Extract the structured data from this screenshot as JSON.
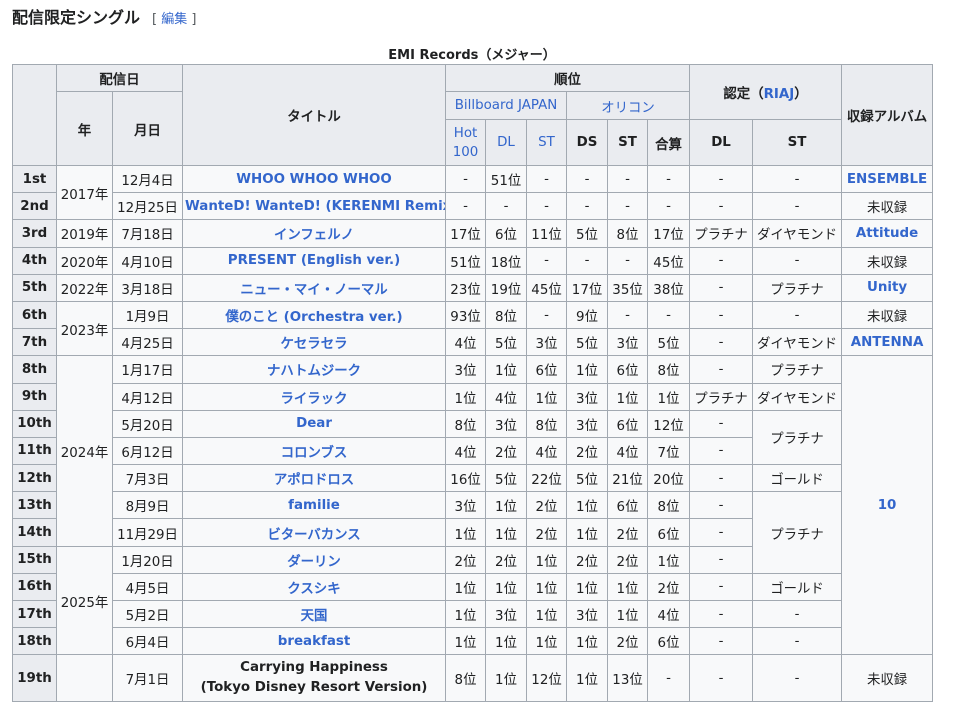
{
  "section": {
    "title": "配信限定シングル",
    "edit_open": "[",
    "edit_label": "編集",
    "edit_close": "]"
  },
  "table": {
    "caption": "EMI Records（メジャー）",
    "headers": {
      "release_date": "配信日",
      "year": "年",
      "month_day": "月日",
      "title": "タイトル",
      "rank": "順位",
      "billboard": "Billboard JAPAN",
      "oricon": "オリコン",
      "hot100": "Hot 100",
      "bb_dl": "DL",
      "bb_st": "ST",
      "or_ds": "DS",
      "or_st": "ST",
      "or_total": "合算",
      "cert_prefix": "認定（",
      "cert_riaj": "RIAJ",
      "cert_suffix": "）",
      "cert_dl": "DL",
      "cert_st": "ST",
      "album": "収録アルバム"
    },
    "years": [
      "2017年",
      "2019年",
      "2020年",
      "2022年",
      "2023年",
      "2024年",
      "2025年"
    ],
    "rows": [
      {
        "no": "1st",
        "date": "12月4日",
        "title": "WHOO WHOO WHOO",
        "hot": "-",
        "dl": "51位",
        "st": "-",
        "ds": "-",
        "ost": "-",
        "tot": "-",
        "cdl": "-",
        "cst": "-",
        "album": "ENSEMBLE"
      },
      {
        "no": "2nd",
        "date": "12月25日",
        "title": "WanteD! WanteD! (KERENMI Remix)",
        "hot": "-",
        "dl": "-",
        "st": "-",
        "ds": "-",
        "ost": "-",
        "tot": "-",
        "cdl": "-",
        "cst": "-",
        "album": "未収録"
      },
      {
        "no": "3rd",
        "date": "7月18日",
        "title": "インフェルノ",
        "hot": "17位",
        "dl": "6位",
        "st": "11位",
        "ds": "5位",
        "ost": "8位",
        "tot": "17位",
        "cdl": "プラチナ",
        "cst": "ダイヤモンド",
        "album": "Attitude"
      },
      {
        "no": "4th",
        "date": "4月10日",
        "title": "PRESENT (English ver.)",
        "hot": "51位",
        "dl": "18位",
        "st": "-",
        "ds": "-",
        "ost": "-",
        "tot": "45位",
        "cdl": "-",
        "cst": "-",
        "album": "未収録"
      },
      {
        "no": "5th",
        "date": "3月18日",
        "title": "ニュー・マイ・ノーマル",
        "hot": "23位",
        "dl": "19位",
        "st": "45位",
        "ds": "17位",
        "ost": "35位",
        "tot": "38位",
        "cdl": "-",
        "cst": "プラチナ",
        "album": "Unity"
      },
      {
        "no": "6th",
        "date": "1月9日",
        "title": "僕のこと (Orchestra ver.)",
        "hot": "93位",
        "dl": "8位",
        "st": "-",
        "ds": "9位",
        "ost": "-",
        "tot": "-",
        "cdl": "-",
        "cst": "-",
        "album": "未収録"
      },
      {
        "no": "7th",
        "date": "4月25日",
        "title": "ケセラセラ",
        "hot": "4位",
        "dl": "5位",
        "st": "3位",
        "ds": "5位",
        "ost": "3位",
        "tot": "5位",
        "cdl": "-",
        "cst": "ダイヤモンド",
        "album": "ANTENNA"
      },
      {
        "no": "8th",
        "date": "1月17日",
        "title": "ナハトムジーク",
        "hot": "3位",
        "dl": "1位",
        "st": "6位",
        "ds": "1位",
        "ost": "6位",
        "tot": "8位",
        "cdl": "-",
        "cst": "プラチナ",
        "album": "10"
      },
      {
        "no": "9th",
        "date": "4月12日",
        "title": "ライラック",
        "hot": "1位",
        "dl": "4位",
        "st": "1位",
        "ds": "3位",
        "ost": "1位",
        "tot": "1位",
        "cdl": "プラチナ",
        "cst": "ダイヤモンド"
      },
      {
        "no": "10th",
        "date": "5月20日",
        "title": "Dear",
        "hot": "8位",
        "dl": "3位",
        "st": "8位",
        "ds": "3位",
        "ost": "6位",
        "tot": "12位",
        "cdl": "-",
        "cst": "プラチナ"
      },
      {
        "no": "11th",
        "date": "6月12日",
        "title": "コロンブス",
        "hot": "4位",
        "dl": "2位",
        "st": "4位",
        "ds": "2位",
        "ost": "4位",
        "tot": "7位",
        "cdl": "-"
      },
      {
        "no": "12th",
        "date": "7月3日",
        "title": "アポロドロス",
        "hot": "16位",
        "dl": "5位",
        "st": "22位",
        "ds": "5位",
        "ost": "21位",
        "tot": "20位",
        "cdl": "-",
        "cst": "ゴールド"
      },
      {
        "no": "13th",
        "date": "8月9日",
        "title": "familie",
        "hot": "3位",
        "dl": "1位",
        "st": "2位",
        "ds": "1位",
        "ost": "6位",
        "tot": "8位",
        "cdl": "-",
        "cst": "プラチナ"
      },
      {
        "no": "14th",
        "date": "11月29日",
        "title": "ビターバカンス",
        "hot": "1位",
        "dl": "1位",
        "st": "2位",
        "ds": "1位",
        "ost": "2位",
        "tot": "6位",
        "cdl": "-"
      },
      {
        "no": "15th",
        "date": "1月20日",
        "title": "ダーリン",
        "hot": "2位",
        "dl": "2位",
        "st": "1位",
        "ds": "2位",
        "ost": "2位",
        "tot": "1位",
        "cdl": "-"
      },
      {
        "no": "16th",
        "date": "4月5日",
        "title": "クスシキ",
        "hot": "1位",
        "dl": "1位",
        "st": "1位",
        "ds": "1位",
        "ost": "1位",
        "tot": "2位",
        "cdl": "-",
        "cst": "ゴールド"
      },
      {
        "no": "17th",
        "date": "5月2日",
        "title": "天国",
        "hot": "1位",
        "dl": "3位",
        "st": "1位",
        "ds": "3位",
        "ost": "1位",
        "tot": "4位",
        "cdl": "-",
        "cst": "-"
      },
      {
        "no": "18th",
        "date": "6月4日",
        "title": "breakfast",
        "hot": "1位",
        "dl": "1位",
        "st": "1位",
        "ds": "1位",
        "ost": "2位",
        "tot": "6位",
        "cdl": "-",
        "cst": "-"
      },
      {
        "no": "19th",
        "year": "",
        "date": "7月1日",
        "title_line1": "Carrying Happiness",
        "title_line2": "(Tokyo Disney Resort Version)",
        "hot": "8位",
        "dl": "1位",
        "st": "12位",
        "ds": "1位",
        "ost": "13位",
        "tot": "-",
        "cdl": "-",
        "cst": "-",
        "album": "未収録"
      }
    ]
  }
}
